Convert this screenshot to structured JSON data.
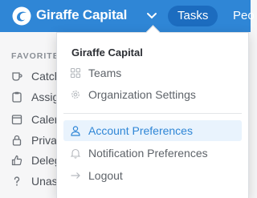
{
  "header": {
    "app_name": "Giraffe Capital",
    "tabs": [
      {
        "label": "Tasks",
        "active": true
      },
      {
        "label": "Peo"
      }
    ]
  },
  "sidebar": {
    "heading": "FAVORITE",
    "items": [
      {
        "label": "Catch",
        "icon": "cup-icon"
      },
      {
        "label": "Assig",
        "icon": "clipboard-icon"
      },
      {
        "label": "Calen",
        "icon": "calendar-icon"
      },
      {
        "label": "Priva",
        "icon": "lock-icon"
      },
      {
        "label": "Deleg",
        "icon": "thumbs-up-icon"
      },
      {
        "label": "Unas",
        "icon": "question-icon"
      }
    ]
  },
  "dropdown": {
    "title": "Giraffe Capital",
    "items": [
      {
        "label": "Teams",
        "icon": "grid-icon"
      },
      {
        "label": "Organization Settings",
        "icon": "gear-icon"
      },
      {
        "label": "Account Preferences",
        "icon": "user-icon",
        "active": true
      },
      {
        "label": "Notification Preferences",
        "icon": "bell-icon"
      },
      {
        "label": "Logout",
        "icon": "arrow-right-icon"
      }
    ]
  },
  "colors": {
    "brand": "#2f86d6",
    "brand_dark": "#1c6cbf",
    "highlight_bg": "#e9f3fd"
  }
}
